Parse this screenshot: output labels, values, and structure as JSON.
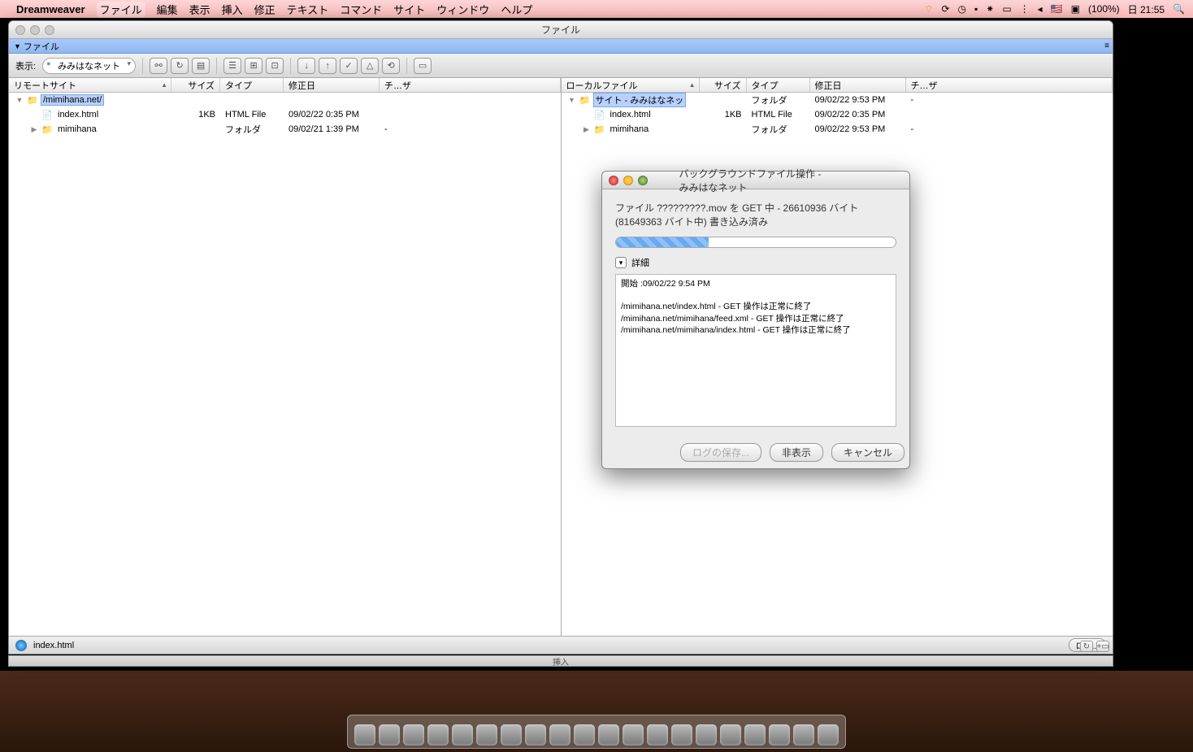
{
  "menubar": {
    "app": "Dreamweaver",
    "items": [
      "ファイル",
      "編集",
      "表示",
      "挿入",
      "修正",
      "テキスト",
      "コマンド",
      "サイト",
      "ウィンドウ",
      "ヘルプ"
    ],
    "battery": "(100%)",
    "clock": "日 21:55"
  },
  "window": {
    "title": "ファイル",
    "subheader": "ファイル",
    "toolbar": {
      "show_label": "表示:",
      "site": "みみはなネット"
    },
    "remote": {
      "header": "リモートサイト",
      "cols": {
        "size": "サイズ",
        "type": "タイプ",
        "modified": "修正日",
        "checked": "チ…ザ"
      },
      "rows": [
        {
          "indent": 0,
          "disc": "▼",
          "icon": "folder",
          "name": "/mimihana.net/",
          "sel": true,
          "size": "",
          "type": "",
          "mod": "",
          "chk": ""
        },
        {
          "indent": 1,
          "disc": "",
          "icon": "file",
          "name": "index.html",
          "size": "1KB",
          "type": "HTML File",
          "mod": "09/02/22 0:35 PM",
          "chk": ""
        },
        {
          "indent": 1,
          "disc": "▶",
          "icon": "folder",
          "name": "mimihana",
          "size": "",
          "type": "フォルダ",
          "mod": "09/02/21 1:39 PM",
          "chk": "-"
        }
      ]
    },
    "local": {
      "header": "ローカルファイル",
      "cols": {
        "size": "サイズ",
        "type": "タイプ",
        "modified": "修正日",
        "checked": "チ…ザ"
      },
      "rows": [
        {
          "indent": 0,
          "disc": "▼",
          "icon": "folder",
          "name": "サイト - みみはなネッ",
          "sel": true,
          "size": "",
          "type": "フォルダ",
          "mod": "09/02/22 9:53 PM",
          "chk": "-"
        },
        {
          "indent": 1,
          "disc": "",
          "icon": "file",
          "name": "index.html",
          "size": "1KB",
          "type": "HTML File",
          "mod": "09/02/22 0:35 PM",
          "chk": ""
        },
        {
          "indent": 1,
          "disc": "▶",
          "icon": "folder",
          "name": "mimihana",
          "size": "",
          "type": "フォルダ",
          "mod": "09/02/22 9:53 PM",
          "chk": "-"
        }
      ]
    },
    "status": {
      "file": "index.html",
      "log_btn": "ログ..."
    }
  },
  "dialog": {
    "title": "バックグラウンドファイル操作 - みみはなネット",
    "line1": "ファイル ?????????.mov を GET 中 - 26610936 バイト",
    "line2": "(81649363 バイト中) 書き込み済み",
    "details_label": "詳細",
    "log": [
      "開始 :09/02/22 9:54 PM",
      "",
      "/mimihana.net/index.html - GET 操作は正常に終了",
      "/mimihana.net/mimihana/feed.xml - GET 操作は正常に終了",
      "/mimihana.net/mimihana/index.html - GET 操作は正常に終了"
    ],
    "buttons": {
      "save": "ログの保存...",
      "hide": "非表示",
      "cancel": "キャンセル"
    }
  },
  "lower_label": "挿入"
}
